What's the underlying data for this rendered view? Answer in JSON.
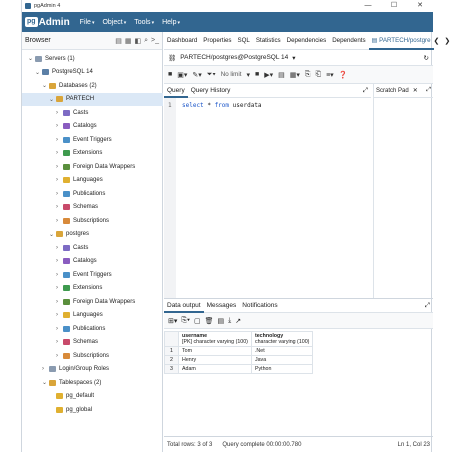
{
  "window": {
    "title": "pgAdmin 4",
    "controls": [
      "—",
      "☐",
      "✕"
    ]
  },
  "menubar": {
    "logo_pg": "pg",
    "logo_admin": "Admin",
    "items": [
      "File",
      "Object",
      "Tools",
      "Help"
    ]
  },
  "browser": {
    "label": "Browser",
    "tree": [
      {
        "label": "Servers (1)",
        "level": 0,
        "chev": "⌄",
        "icon": "server-group",
        "color": "#8a9bb0"
      },
      {
        "label": "PostgreSQL 14",
        "level": 1,
        "chev": "⌄",
        "icon": "elephant",
        "color": "#5b7fa6"
      },
      {
        "label": "Databases (2)",
        "level": 2,
        "chev": "⌄",
        "icon": "databases",
        "color": "#d9a53a"
      },
      {
        "label": "PARTECH",
        "level": 3,
        "chev": "⌄",
        "icon": "database",
        "color": "#d9a53a",
        "selected": true
      },
      {
        "label": "Casts",
        "level": 4,
        "chev": "›",
        "icon": "casts",
        "color": "#7d6bc4"
      },
      {
        "label": "Catalogs",
        "level": 4,
        "chev": "›",
        "icon": "catalogs",
        "color": "#8a5cc0"
      },
      {
        "label": "Event Triggers",
        "level": 4,
        "chev": "›",
        "icon": "event-trigger",
        "color": "#4a90c8"
      },
      {
        "label": "Extensions",
        "level": 4,
        "chev": "›",
        "icon": "extension",
        "color": "#3e9a4e"
      },
      {
        "label": "Foreign Data Wrappers",
        "level": 4,
        "chev": "›",
        "icon": "fdw",
        "color": "#5a8f3c"
      },
      {
        "label": "Languages",
        "level": 4,
        "chev": "›",
        "icon": "language",
        "color": "#e0b030"
      },
      {
        "label": "Publications",
        "level": 4,
        "chev": "›",
        "icon": "publication",
        "color": "#4a90c8"
      },
      {
        "label": "Schemas",
        "level": 4,
        "chev": "›",
        "icon": "schema",
        "color": "#c84a6a"
      },
      {
        "label": "Subscriptions",
        "level": 4,
        "chev": "›",
        "icon": "subscription",
        "color": "#d88a3a"
      },
      {
        "label": "postgres",
        "level": 3,
        "chev": "⌄",
        "icon": "database",
        "color": "#d9a53a"
      },
      {
        "label": "Casts",
        "level": 4,
        "chev": "›",
        "icon": "casts",
        "color": "#7d6bc4"
      },
      {
        "label": "Catalogs",
        "level": 4,
        "chev": "›",
        "icon": "catalogs",
        "color": "#8a5cc0"
      },
      {
        "label": "Event Triggers",
        "level": 4,
        "chev": "›",
        "icon": "event-trigger",
        "color": "#4a90c8"
      },
      {
        "label": "Extensions",
        "level": 4,
        "chev": "›",
        "icon": "extension",
        "color": "#3e9a4e"
      },
      {
        "label": "Foreign Data Wrappers",
        "level": 4,
        "chev": "›",
        "icon": "fdw",
        "color": "#5a8f3c"
      },
      {
        "label": "Languages",
        "level": 4,
        "chev": "›",
        "icon": "language",
        "color": "#e0b030"
      },
      {
        "label": "Publications",
        "level": 4,
        "chev": "›",
        "icon": "publication",
        "color": "#4a90c8"
      },
      {
        "label": "Schemas",
        "level": 4,
        "chev": "›",
        "icon": "schema",
        "color": "#c84a6a"
      },
      {
        "label": "Subscriptions",
        "level": 4,
        "chev": "›",
        "icon": "subscription",
        "color": "#d88a3a"
      },
      {
        "label": "Login/Group Roles",
        "level": 2,
        "chev": "›",
        "icon": "roles",
        "color": "#8a9bb0"
      },
      {
        "label": "Tablespaces (2)",
        "level": 2,
        "chev": "⌄",
        "icon": "tablespaces",
        "color": "#d9a53a"
      },
      {
        "label": "pg_default",
        "level": 3,
        "chev": "",
        "icon": "tablespace",
        "color": "#e0b030"
      },
      {
        "label": "pg_global",
        "level": 3,
        "chev": "",
        "icon": "tablespace",
        "color": "#e0b030"
      }
    ]
  },
  "tabs": {
    "items": [
      "Dashboard",
      "Properties",
      "SQL",
      "Statistics",
      "Dependencies",
      "Dependents"
    ],
    "active_label": "PARTECH/postgre",
    "close": "✕"
  },
  "connection": {
    "text": "PARTECH/postgres@PostgreSQL 14"
  },
  "query_toolbar": {
    "limit_label": "No limit"
  },
  "query": {
    "tab_query": "Query",
    "tab_history": "Query History",
    "line_no": "1",
    "kw_select": "select",
    "star": "*",
    "kw_from": "from",
    "table": "userdata",
    "scratch_pad": "Scratch Pad",
    "scratch_close": "✕"
  },
  "output": {
    "tabs": [
      "Data output",
      "Messages",
      "Notifications"
    ],
    "columns": [
      {
        "name": "username",
        "type": "[PK] character varying (100)"
      },
      {
        "name": "technology",
        "type": "character varying (100)"
      }
    ],
    "rows": [
      {
        "n": "1",
        "username": "Tom",
        "technology": ".Net"
      },
      {
        "n": "2",
        "username": "Henry",
        "technology": "Java"
      },
      {
        "n": "3",
        "username": "Adam",
        "technology": "Python"
      }
    ]
  },
  "status": {
    "total_rows": "Total rows: 3 of 3",
    "query_complete": "Query complete 00:00:00.780",
    "position": "Ln 1, Col 23"
  }
}
